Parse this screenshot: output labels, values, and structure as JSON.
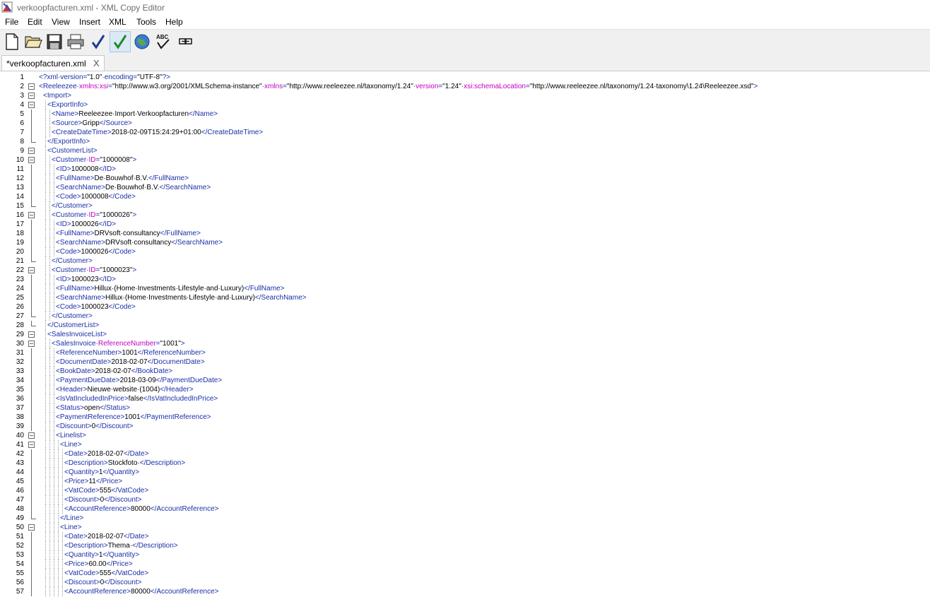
{
  "window": {
    "title": "verkoopfacturen.xml - XML Copy Editor",
    "app_icon": "xml-copy-editor-icon"
  },
  "menu": [
    "File",
    "Edit",
    "View",
    "Insert",
    "XML",
    "Tools",
    "Help"
  ],
  "toolbar": {
    "buttons": [
      "new-document",
      "open-folder",
      "save",
      "print",
      "check-well-formed",
      "validate",
      "browser",
      "spellcheck",
      "xsl-transform"
    ]
  },
  "tabs": [
    {
      "label": "*verkoopfacturen.xml",
      "close": "X"
    }
  ],
  "editor": {
    "lines": [
      {
        "n": "1",
        "i": 0,
        "f": "",
        "tk": [
          [
            "t",
            "<?xml·version="
          ],
          [
            "v",
            "\"1.0\""
          ],
          [
            "t",
            "·encoding="
          ],
          [
            "v",
            "\"UTF-8\""
          ],
          [
            "t",
            "?>"
          ]
        ]
      },
      {
        "n": "2",
        "i": 0,
        "f": "open",
        "tk": [
          [
            "t",
            "<Reeleezee·"
          ],
          [
            "a",
            "xmlns:xsi"
          ],
          [
            "t",
            "="
          ],
          [
            "v",
            "\"http://www.w3.org/2001/XMLSchema-instance\""
          ],
          [
            "t",
            "·"
          ],
          [
            "a",
            "xmlns"
          ],
          [
            "t",
            "="
          ],
          [
            "v",
            "\"http://www.reeleezee.nl/taxonomy/1.24\""
          ],
          [
            "t",
            "·"
          ],
          [
            "a",
            "version"
          ],
          [
            "t",
            "="
          ],
          [
            "v",
            "\"1.24\""
          ],
          [
            "t",
            "·"
          ],
          [
            "a",
            "xsi:schemaLocation"
          ],
          [
            "t",
            "="
          ],
          [
            "v",
            "\"http://www.reeleezee.nl/taxonomy/1.24·taxonomy\\1.24\\Reeleezee.xsd\""
          ],
          [
            "t",
            ">"
          ]
        ]
      },
      {
        "n": "3",
        "i": 1,
        "f": "open",
        "tk": [
          [
            "t",
            "<Import>"
          ]
        ]
      },
      {
        "n": "4",
        "i": 2,
        "f": "open",
        "tk": [
          [
            "t",
            "<ExportInfo>"
          ]
        ]
      },
      {
        "n": "5",
        "i": 3,
        "f": "bar",
        "tk": [
          [
            "t",
            "<Name>"
          ],
          [
            "x",
            "Reeleezee·Import·Verkoopfacturen"
          ],
          [
            "t",
            "</Name>"
          ]
        ]
      },
      {
        "n": "6",
        "i": 3,
        "f": "bar",
        "tk": [
          [
            "t",
            "<Source>"
          ],
          [
            "x",
            "Gripp"
          ],
          [
            "t",
            "</Source>"
          ]
        ]
      },
      {
        "n": "7",
        "i": 3,
        "f": "bar",
        "tk": [
          [
            "t",
            "<CreateDateTime>"
          ],
          [
            "x",
            "2018-02-09T15:24:29+01:00"
          ],
          [
            "t",
            "</CreateDateTime>"
          ]
        ]
      },
      {
        "n": "8",
        "i": 2,
        "f": "end",
        "tk": [
          [
            "t",
            "</ExportInfo>"
          ]
        ]
      },
      {
        "n": "9",
        "i": 2,
        "f": "open",
        "tk": [
          [
            "t",
            "<CustomerList>"
          ]
        ]
      },
      {
        "n": "10",
        "i": 3,
        "f": "open",
        "tk": [
          [
            "t",
            "<Customer·"
          ],
          [
            "a",
            "ID"
          ],
          [
            "t",
            "="
          ],
          [
            "v",
            "\"1000008\""
          ],
          [
            "t",
            ">"
          ]
        ]
      },
      {
        "n": "11",
        "i": 4,
        "f": "bar",
        "tk": [
          [
            "t",
            "<ID>"
          ],
          [
            "x",
            "1000008"
          ],
          [
            "t",
            "</ID>"
          ]
        ]
      },
      {
        "n": "12",
        "i": 4,
        "f": "bar",
        "tk": [
          [
            "t",
            "<FullName>"
          ],
          [
            "x",
            "De·Bouwhof·B.V."
          ],
          [
            "t",
            "</FullName>"
          ]
        ]
      },
      {
        "n": "13",
        "i": 4,
        "f": "bar",
        "tk": [
          [
            "t",
            "<SearchName>"
          ],
          [
            "x",
            "De·Bouwhof·B.V."
          ],
          [
            "t",
            "</SearchName>"
          ]
        ]
      },
      {
        "n": "14",
        "i": 4,
        "f": "bar",
        "tk": [
          [
            "t",
            "<Code>"
          ],
          [
            "x",
            "1000008"
          ],
          [
            "t",
            "</Code>"
          ]
        ]
      },
      {
        "n": "15",
        "i": 3,
        "f": "end",
        "tk": [
          [
            "t",
            "</Customer>"
          ]
        ]
      },
      {
        "n": "16",
        "i": 3,
        "f": "open",
        "tk": [
          [
            "t",
            "<Customer·"
          ],
          [
            "a",
            "ID"
          ],
          [
            "t",
            "="
          ],
          [
            "v",
            "\"1000026\""
          ],
          [
            "t",
            ">"
          ]
        ]
      },
      {
        "n": "17",
        "i": 4,
        "f": "bar",
        "tk": [
          [
            "t",
            "<ID>"
          ],
          [
            "x",
            "1000026"
          ],
          [
            "t",
            "</ID>"
          ]
        ]
      },
      {
        "n": "18",
        "i": 4,
        "f": "bar",
        "tk": [
          [
            "t",
            "<FullName>"
          ],
          [
            "x",
            "DRVsoft·consultancy"
          ],
          [
            "t",
            "</FullName>"
          ]
        ]
      },
      {
        "n": "19",
        "i": 4,
        "f": "bar",
        "tk": [
          [
            "t",
            "<SearchName>"
          ],
          [
            "x",
            "DRVsoft·consultancy"
          ],
          [
            "t",
            "</SearchName>"
          ]
        ]
      },
      {
        "n": "20",
        "i": 4,
        "f": "bar",
        "tk": [
          [
            "t",
            "<Code>"
          ],
          [
            "x",
            "1000026"
          ],
          [
            "t",
            "</Code>"
          ]
        ]
      },
      {
        "n": "21",
        "i": 3,
        "f": "end",
        "tk": [
          [
            "t",
            "</Customer>"
          ]
        ]
      },
      {
        "n": "22",
        "i": 3,
        "f": "open",
        "tk": [
          [
            "t",
            "<Customer·"
          ],
          [
            "a",
            "ID"
          ],
          [
            "t",
            "="
          ],
          [
            "v",
            "\"1000023\""
          ],
          [
            "t",
            ">"
          ]
        ]
      },
      {
        "n": "23",
        "i": 4,
        "f": "bar",
        "tk": [
          [
            "t",
            "<ID>"
          ],
          [
            "x",
            "1000023"
          ],
          [
            "t",
            "</ID>"
          ]
        ]
      },
      {
        "n": "24",
        "i": 4,
        "f": "bar",
        "tk": [
          [
            "t",
            "<FullName>"
          ],
          [
            "x",
            "Hillux·(Home·Investments·Lifestyle·and·Luxury)"
          ],
          [
            "t",
            "</FullName>"
          ]
        ]
      },
      {
        "n": "25",
        "i": 4,
        "f": "bar",
        "tk": [
          [
            "t",
            "<SearchName>"
          ],
          [
            "x",
            "Hillux·(Home·Investments·Lifestyle·and·Luxury)"
          ],
          [
            "t",
            "</SearchName>"
          ]
        ]
      },
      {
        "n": "26",
        "i": 4,
        "f": "bar",
        "tk": [
          [
            "t",
            "<Code>"
          ],
          [
            "x",
            "1000023"
          ],
          [
            "t",
            "</Code>"
          ]
        ]
      },
      {
        "n": "27",
        "i": 3,
        "f": "end",
        "tk": [
          [
            "t",
            "</Customer>"
          ]
        ]
      },
      {
        "n": "28",
        "i": 2,
        "f": "end",
        "tk": [
          [
            "t",
            "</CustomerList>"
          ]
        ]
      },
      {
        "n": "29",
        "i": 2,
        "f": "open",
        "tk": [
          [
            "t",
            "<SalesInvoiceList>"
          ]
        ]
      },
      {
        "n": "30",
        "i": 3,
        "f": "open",
        "tk": [
          [
            "t",
            "<SalesInvoice·"
          ],
          [
            "a",
            "ReferenceNumber"
          ],
          [
            "t",
            "="
          ],
          [
            "v",
            "\"1001\""
          ],
          [
            "t",
            ">"
          ]
        ]
      },
      {
        "n": "31",
        "i": 4,
        "f": "bar",
        "tk": [
          [
            "t",
            "<ReferenceNumber>"
          ],
          [
            "x",
            "1001"
          ],
          [
            "t",
            "</ReferenceNumber>"
          ]
        ]
      },
      {
        "n": "32",
        "i": 4,
        "f": "bar",
        "tk": [
          [
            "t",
            "<DocumentDate>"
          ],
          [
            "x",
            "2018-02-07"
          ],
          [
            "t",
            "</DocumentDate>"
          ]
        ]
      },
      {
        "n": "33",
        "i": 4,
        "f": "bar",
        "tk": [
          [
            "t",
            "<BookDate>"
          ],
          [
            "x",
            "2018-02-07"
          ],
          [
            "t",
            "</BookDate>"
          ]
        ]
      },
      {
        "n": "34",
        "i": 4,
        "f": "bar",
        "tk": [
          [
            "t",
            "<PaymentDueDate>"
          ],
          [
            "x",
            "2018-03-09"
          ],
          [
            "t",
            "</PaymentDueDate>"
          ]
        ]
      },
      {
        "n": "35",
        "i": 4,
        "f": "bar",
        "tk": [
          [
            "t",
            "<Header>"
          ],
          [
            "x",
            "Nieuwe·website·(1004)"
          ],
          [
            "t",
            "</Header>"
          ]
        ]
      },
      {
        "n": "36",
        "i": 4,
        "f": "bar",
        "tk": [
          [
            "t",
            "<IsVatIncludedInPrice>"
          ],
          [
            "x",
            "false"
          ],
          [
            "t",
            "</IsVatIncludedInPrice>"
          ]
        ]
      },
      {
        "n": "37",
        "i": 4,
        "f": "bar",
        "tk": [
          [
            "t",
            "<Status>"
          ],
          [
            "x",
            "open"
          ],
          [
            "t",
            "</Status>"
          ]
        ]
      },
      {
        "n": "38",
        "i": 4,
        "f": "bar",
        "tk": [
          [
            "t",
            "<PaymentReference>"
          ],
          [
            "x",
            "1001"
          ],
          [
            "t",
            "</PaymentReference>"
          ]
        ]
      },
      {
        "n": "39",
        "i": 4,
        "f": "bar",
        "tk": [
          [
            "t",
            "<Discount>"
          ],
          [
            "x",
            "0"
          ],
          [
            "t",
            "</Discount>"
          ]
        ]
      },
      {
        "n": "40",
        "i": 4,
        "f": "open",
        "tk": [
          [
            "t",
            "<Linelist>"
          ]
        ]
      },
      {
        "n": "41",
        "i": 5,
        "f": "open",
        "tk": [
          [
            "t",
            "<Line>"
          ]
        ]
      },
      {
        "n": "42",
        "i": 6,
        "f": "bar",
        "tk": [
          [
            "t",
            "<Date>"
          ],
          [
            "x",
            "2018-02-07"
          ],
          [
            "t",
            "</Date>"
          ]
        ]
      },
      {
        "n": "43",
        "i": 6,
        "f": "bar",
        "tk": [
          [
            "t",
            "<Description>"
          ],
          [
            "x",
            "Stockfoto·"
          ],
          [
            "t",
            "</Description>"
          ]
        ]
      },
      {
        "n": "44",
        "i": 6,
        "f": "bar",
        "tk": [
          [
            "t",
            "<Quantity>"
          ],
          [
            "x",
            "1"
          ],
          [
            "t",
            "</Quantity>"
          ]
        ]
      },
      {
        "n": "45",
        "i": 6,
        "f": "bar",
        "tk": [
          [
            "t",
            "<Price>"
          ],
          [
            "x",
            "11"
          ],
          [
            "t",
            "</Price>"
          ]
        ]
      },
      {
        "n": "46",
        "i": 6,
        "f": "bar",
        "tk": [
          [
            "t",
            "<VatCode>"
          ],
          [
            "x",
            "555"
          ],
          [
            "t",
            "</VatCode>"
          ]
        ]
      },
      {
        "n": "47",
        "i": 6,
        "f": "bar",
        "tk": [
          [
            "t",
            "<Discount>"
          ],
          [
            "x",
            "0"
          ],
          [
            "t",
            "</Discount>"
          ]
        ]
      },
      {
        "n": "48",
        "i": 6,
        "f": "bar",
        "tk": [
          [
            "t",
            "<AccountReference>"
          ],
          [
            "x",
            "80000"
          ],
          [
            "t",
            "</AccountReference>"
          ]
        ]
      },
      {
        "n": "49",
        "i": 5,
        "f": "end",
        "tk": [
          [
            "t",
            "</Line>"
          ]
        ]
      },
      {
        "n": "50",
        "i": 5,
        "f": "open",
        "tk": [
          [
            "t",
            "<Line>"
          ]
        ]
      },
      {
        "n": "51",
        "i": 6,
        "f": "bar",
        "tk": [
          [
            "t",
            "<Date>"
          ],
          [
            "x",
            "2018-02-07"
          ],
          [
            "t",
            "</Date>"
          ]
        ]
      },
      {
        "n": "52",
        "i": 6,
        "f": "bar",
        "tk": [
          [
            "t",
            "<Description>"
          ],
          [
            "x",
            "Thema·"
          ],
          [
            "t",
            "</Description>"
          ]
        ]
      },
      {
        "n": "53",
        "i": 6,
        "f": "bar",
        "tk": [
          [
            "t",
            "<Quantity>"
          ],
          [
            "x",
            "1"
          ],
          [
            "t",
            "</Quantity>"
          ]
        ]
      },
      {
        "n": "54",
        "i": 6,
        "f": "bar",
        "tk": [
          [
            "t",
            "<Price>"
          ],
          [
            "x",
            "60.00"
          ],
          [
            "t",
            "</Price>"
          ]
        ]
      },
      {
        "n": "55",
        "i": 6,
        "f": "bar",
        "tk": [
          [
            "t",
            "<VatCode>"
          ],
          [
            "x",
            "555"
          ],
          [
            "t",
            "</VatCode>"
          ]
        ]
      },
      {
        "n": "56",
        "i": 6,
        "f": "bar",
        "tk": [
          [
            "t",
            "<Discount>"
          ],
          [
            "x",
            "0"
          ],
          [
            "t",
            "</Discount>"
          ]
        ]
      },
      {
        "n": "57",
        "i": 6,
        "f": "bar",
        "tk": [
          [
            "t",
            "<AccountReference>"
          ],
          [
            "x",
            "80000"
          ],
          [
            "t",
            "</AccountReference>"
          ]
        ]
      }
    ]
  },
  "colors": {
    "tag": "#1b2fa6",
    "attribute": "#c000c0",
    "value": "#000000",
    "text": "#000000"
  }
}
